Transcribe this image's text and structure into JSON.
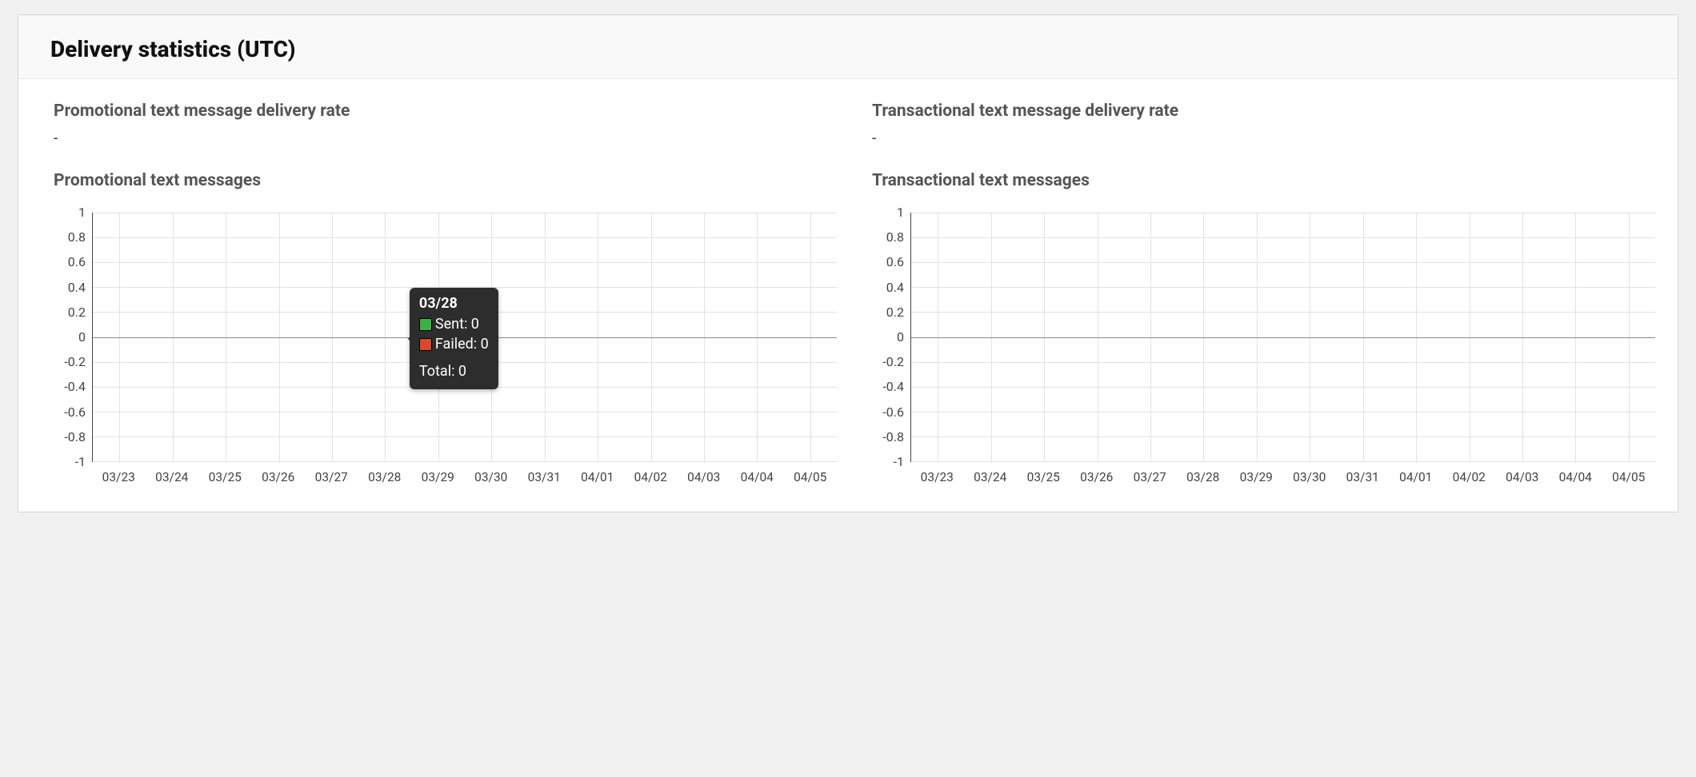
{
  "panel": {
    "title": "Delivery statistics (UTC)"
  },
  "left": {
    "rate_label": "Promotional text message delivery rate",
    "rate_value": "-",
    "chart_title": "Promotional text messages"
  },
  "right": {
    "rate_label": "Transactional text message delivery rate",
    "rate_value": "-",
    "chart_title": "Transactional text messages"
  },
  "tooltip": {
    "date": "03/28",
    "sent_label": "Sent: 0",
    "failed_label": "Failed: 0",
    "total_label": "Total: 0"
  },
  "chart_data": [
    {
      "id": "promotional",
      "type": "line",
      "title": "Promotional text messages",
      "xlabel": "",
      "ylabel": "",
      "ylim": [
        -1,
        1
      ],
      "y_ticks": [
        1,
        0.8,
        0.6,
        0.4,
        0.2,
        0,
        -0.2,
        -0.4,
        -0.6,
        -0.8,
        -1
      ],
      "categories": [
        "03/23",
        "03/24",
        "03/25",
        "03/26",
        "03/27",
        "03/28",
        "03/29",
        "03/30",
        "03/31",
        "04/01",
        "04/02",
        "04/03",
        "04/04",
        "04/05"
      ],
      "series": [
        {
          "name": "Sent",
          "color": "#3bb143",
          "values": [
            0,
            0,
            0,
            0,
            0,
            0,
            0,
            0,
            0,
            0,
            0,
            0,
            0,
            0
          ]
        },
        {
          "name": "Failed",
          "color": "#d94a2d",
          "values": [
            0,
            0,
            0,
            0,
            0,
            0,
            0,
            0,
            0,
            0,
            0,
            0,
            0,
            0
          ]
        }
      ],
      "totals": [
        0,
        0,
        0,
        0,
        0,
        0,
        0,
        0,
        0,
        0,
        0,
        0,
        0,
        0
      ]
    },
    {
      "id": "transactional",
      "type": "line",
      "title": "Transactional text messages",
      "xlabel": "",
      "ylabel": "",
      "ylim": [
        -1,
        1
      ],
      "y_ticks": [
        1,
        0.8,
        0.6,
        0.4,
        0.2,
        0,
        -0.2,
        -0.4,
        -0.6,
        -0.8,
        -1
      ],
      "categories": [
        "03/23",
        "03/24",
        "03/25",
        "03/26",
        "03/27",
        "03/28",
        "03/29",
        "03/30",
        "03/31",
        "04/01",
        "04/02",
        "04/03",
        "04/04",
        "04/05"
      ],
      "series": [
        {
          "name": "Sent",
          "color": "#3bb143",
          "values": [
            0,
            0,
            0,
            0,
            0,
            0,
            0,
            0,
            0,
            0,
            0,
            0,
            0,
            0
          ]
        },
        {
          "name": "Failed",
          "color": "#d94a2d",
          "values": [
            0,
            0,
            0,
            0,
            0,
            0,
            0,
            0,
            0,
            0,
            0,
            0,
            0,
            0
          ]
        }
      ],
      "totals": [
        0,
        0,
        0,
        0,
        0,
        0,
        0,
        0,
        0,
        0,
        0,
        0,
        0,
        0
      ]
    }
  ]
}
